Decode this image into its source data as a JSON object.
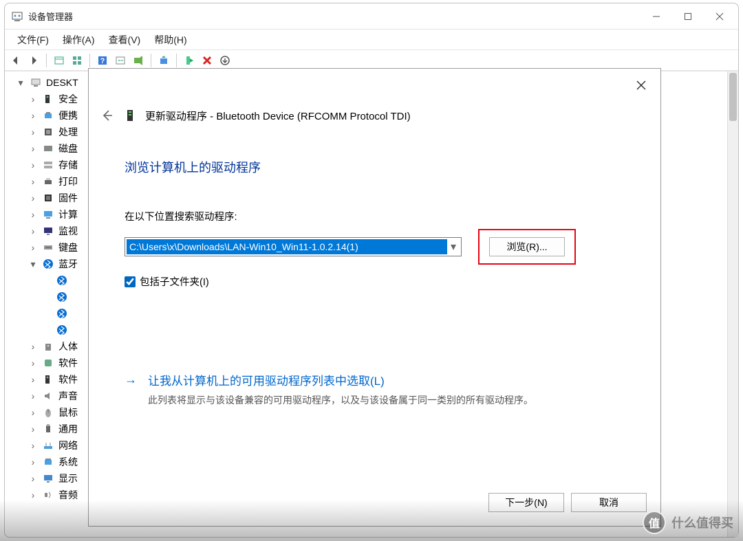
{
  "window": {
    "title": "设备管理器",
    "win_controls": {
      "min": "minimize",
      "max": "maximize",
      "close": "close"
    }
  },
  "menu": {
    "file": "文件(F)",
    "action": "操作(A)",
    "view": "查看(V)",
    "help": "帮助(H)"
  },
  "toolbar": {
    "back": "back-icon",
    "forward": "forward-icon",
    "show_hide": "show-hide-icon",
    "find": "find-icon",
    "help": "help-icon",
    "props": "properties-icon",
    "scan": "scan-hardware-icon",
    "view1": "view-icon",
    "add": "add-device-icon",
    "remove": "remove-icon",
    "update": "update-icon"
  },
  "tree": {
    "root": "DESKT",
    "items": [
      {
        "icon": "security",
        "label": "安全"
      },
      {
        "icon": "portable",
        "label": "便携"
      },
      {
        "icon": "cpu",
        "label": "处理"
      },
      {
        "icon": "disk",
        "label": "磁盘"
      },
      {
        "icon": "storage",
        "label": "存储"
      },
      {
        "icon": "printer",
        "label": "打印"
      },
      {
        "icon": "firmware",
        "label": "固件"
      },
      {
        "icon": "computer",
        "label": "计算"
      },
      {
        "icon": "monitor",
        "label": "监视"
      },
      {
        "icon": "keyboard",
        "label": "键盘"
      },
      {
        "icon": "bluetooth",
        "label": "蓝牙",
        "expanded": true,
        "children": [
          "",
          "",
          "",
          ""
        ]
      },
      {
        "icon": "hid",
        "label": "人体"
      },
      {
        "icon": "software",
        "label": "软件"
      },
      {
        "icon": "software2",
        "label": "软件"
      },
      {
        "icon": "audio",
        "label": "声音"
      },
      {
        "icon": "mouse",
        "label": "鼠标"
      },
      {
        "icon": "usb",
        "label": "通用"
      },
      {
        "icon": "network",
        "label": "网络"
      },
      {
        "icon": "system",
        "label": "系统"
      },
      {
        "icon": "display",
        "label": "显示"
      },
      {
        "icon": "sound",
        "label": "音频"
      }
    ]
  },
  "dialog": {
    "header_prefix": "更新驱动程序 - ",
    "device_name": "Bluetooth Device (RFCOMM Protocol TDI)",
    "section_title": "浏览计算机上的驱动程序",
    "field_label": "在以下位置搜索驱动程序:",
    "path_value": "C:\\Users\\x\\Downloads\\LAN-Win10_Win11-1.0.2.14(1)",
    "browse_button": "浏览(R)...",
    "include_sub_label": "包括子文件夹(I)",
    "include_sub_checked": true,
    "pick_link_title": "让我从计算机上的可用驱动程序列表中选取(L)",
    "pick_link_desc": "此列表将显示与该设备兼容的可用驱动程序，以及与该设备属于同一类别的所有驱动程序。",
    "next_button": "下一步(N)",
    "cancel_button": "取消"
  },
  "watermark": {
    "logo": "值",
    "text": "什么值得买"
  }
}
